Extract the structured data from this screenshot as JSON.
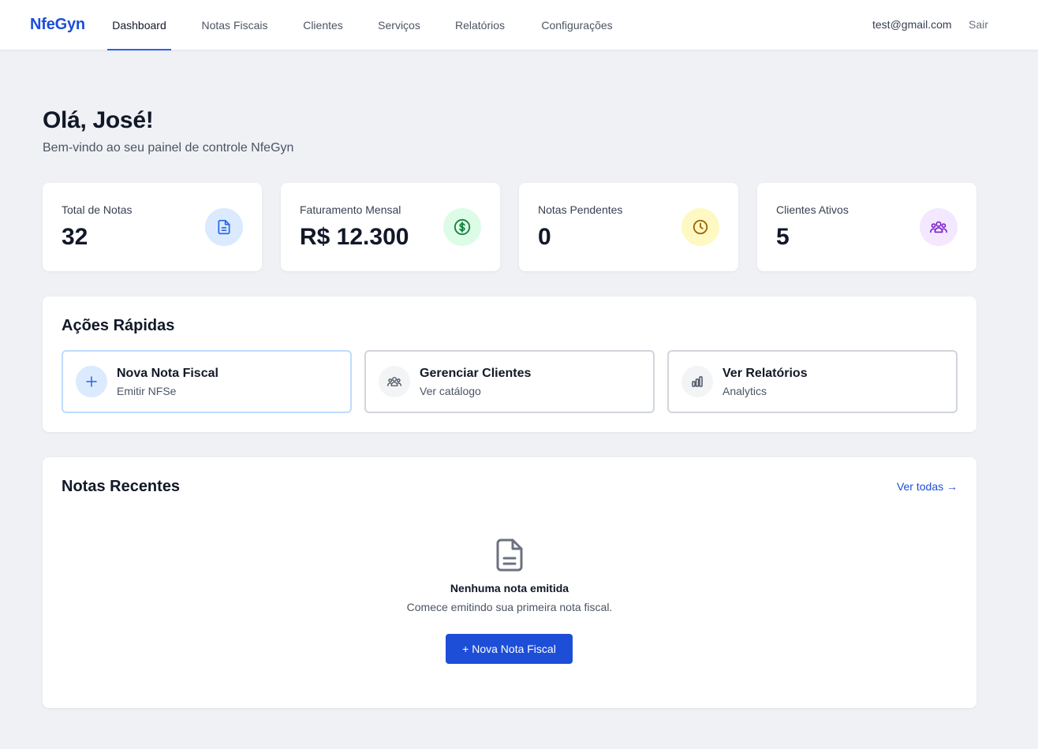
{
  "app": {
    "logo": "NfeGyn"
  },
  "nav": {
    "items": [
      {
        "label": "Dashboard",
        "active": true
      },
      {
        "label": "Notas Fiscais"
      },
      {
        "label": "Clientes"
      },
      {
        "label": "Serviços"
      },
      {
        "label": "Relatórios"
      },
      {
        "label": "Configurações"
      }
    ],
    "user_email": "test@gmail.com",
    "logout_label": "Sair"
  },
  "greeting": {
    "title": "Olá, José!",
    "subtitle": "Bem-vindo ao seu painel de controle NfeGyn"
  },
  "stats": [
    {
      "label": "Total de Notas",
      "value": "32",
      "icon": "document-icon",
      "icon_bg": "#dbeafe",
      "icon_color": "#2563eb"
    },
    {
      "label": "Faturamento Mensal",
      "value": "R$ 12.300",
      "icon": "dollar-icon",
      "icon_bg": "#dcfce7",
      "icon_color": "#15803d"
    },
    {
      "label": "Notas Pendentes",
      "value": "0",
      "icon": "clock-icon",
      "icon_bg": "#fef9c3",
      "icon_color": "#a16207"
    },
    {
      "label": "Clientes Ativos",
      "value": "5",
      "icon": "users-icon",
      "icon_bg": "#f3e8ff",
      "icon_color": "#7e22ce"
    }
  ],
  "quick_actions": {
    "title": "Ações Rápidas",
    "items": [
      {
        "title": "Nova Nota Fiscal",
        "subtitle": "Emitir NFSe",
        "icon": "plus-icon"
      },
      {
        "title": "Gerenciar Clientes",
        "subtitle": "Ver catálogo",
        "icon": "users-icon"
      },
      {
        "title": "Ver Relatórios",
        "subtitle": "Analytics",
        "icon": "bar-chart-icon"
      }
    ]
  },
  "recent": {
    "title": "Notas Recentes",
    "see_all": "Ver todas →",
    "empty_title": "Nenhuma nota emitida",
    "empty_subtitle": "Comece emitindo sua primeira nota fiscal.",
    "new_button": "+ Nova Nota Fiscal"
  },
  "colors": {
    "accent": "#1d4ed8",
    "background": "#f0f1f5"
  }
}
